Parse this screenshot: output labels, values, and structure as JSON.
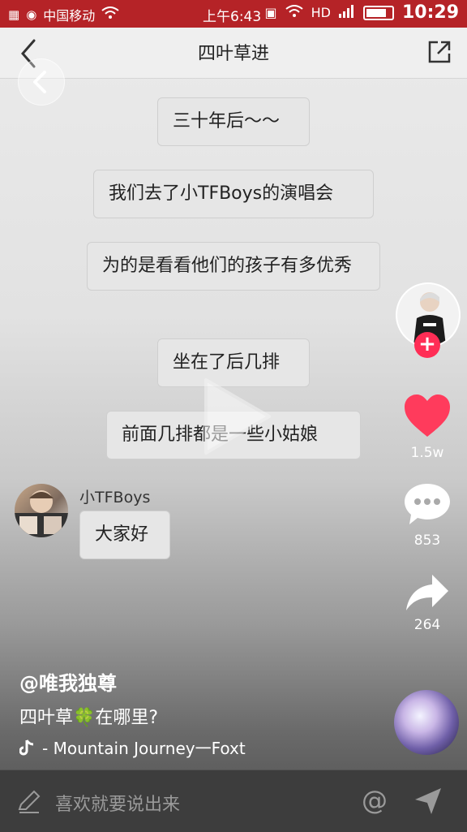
{
  "status_bar": {
    "carrier": "中国移动",
    "clock": "上午6:43",
    "network": "HD",
    "time": "10:29"
  },
  "nav": {
    "title": "四叶草进"
  },
  "chat": {
    "messages": [
      "三十年后～～",
      "我们去了小TFBoys的演唱会",
      "为的是看看他们的孩子有多优秀",
      "坐在了后几排",
      "前面几排都是一些小姑娘"
    ],
    "reply_sender": "小TFBoys",
    "reply_text": "大家好"
  },
  "actions": {
    "likes": "1.5w",
    "comments": "853",
    "shares": "264",
    "follow_symbol": "+"
  },
  "post": {
    "username": "@唯我独尊",
    "caption_before": "四叶草",
    "caption_emoji": "🍀",
    "caption_after": "在哪里?",
    "music": "- Mountain Journey一Foxt"
  },
  "comment_bar": {
    "placeholder": "喜欢就要说出来"
  },
  "colors": {
    "status_bar": "#b52327",
    "like": "#ff3b5c",
    "follow": "#ff2d55"
  }
}
